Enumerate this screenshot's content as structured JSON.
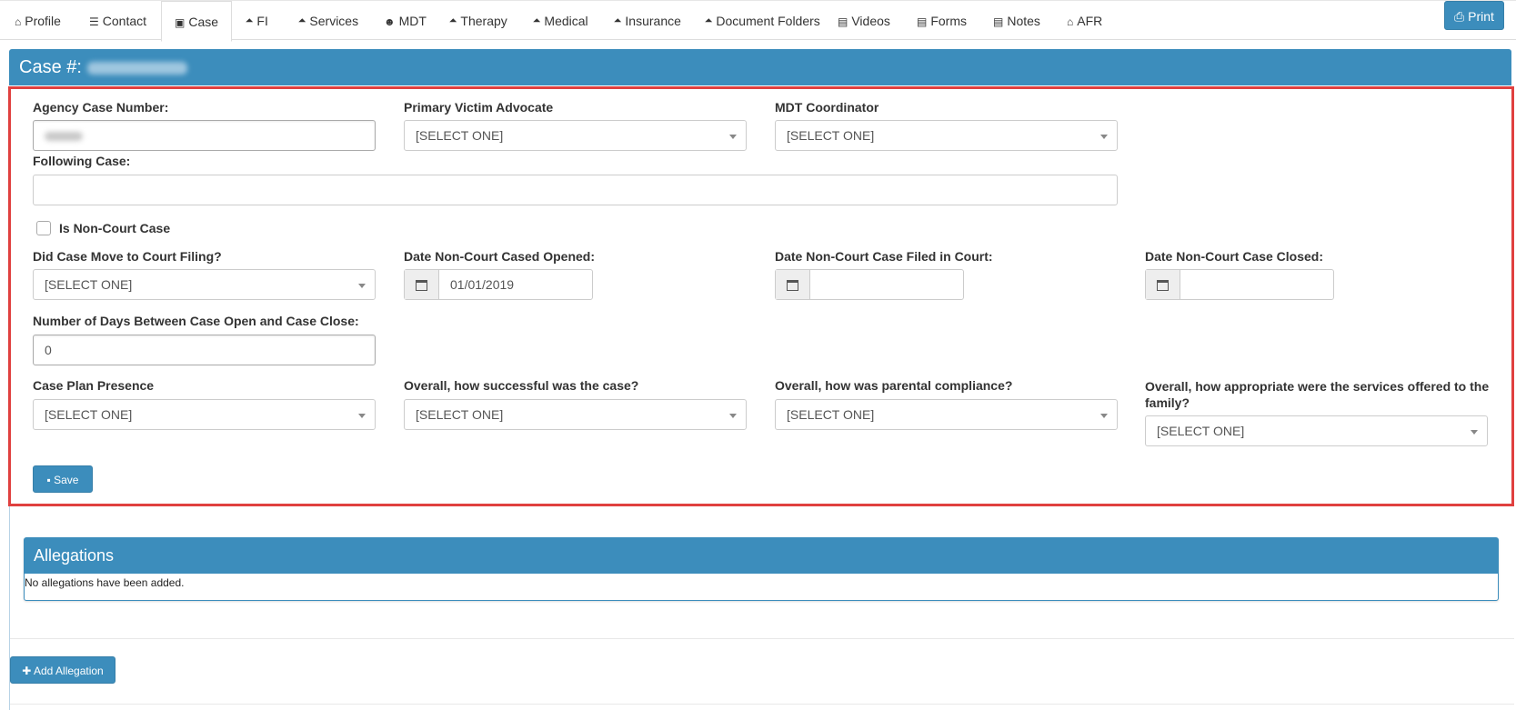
{
  "tabs": [
    {
      "label": "Profile",
      "icon": "⌂"
    },
    {
      "label": "Contact",
      "icon": "☰"
    },
    {
      "label": "Case",
      "icon": "▣"
    },
    {
      "label": "FI",
      "icon": "🞁"
    },
    {
      "label": "Services",
      "icon": "🞁"
    },
    {
      "label": "MDT",
      "icon": "☻"
    },
    {
      "label": "Therapy",
      "icon": "🞁"
    },
    {
      "label": "Medical",
      "icon": "🞁"
    },
    {
      "label": "Insurance",
      "icon": "🞁"
    },
    {
      "label": "Document Folders",
      "icon": "🞁"
    },
    {
      "label": "Videos",
      "icon": "▤"
    },
    {
      "label": "Forms",
      "icon": "▤"
    },
    {
      "label": "Notes",
      "icon": "▤"
    },
    {
      "label": "AFR",
      "icon": "⌂"
    }
  ],
  "print": {
    "label": "Print",
    "icon": "⎙"
  },
  "case": {
    "title": "Case #:",
    "labels": {
      "agency_case_number": "Agency Case Number:",
      "primary_victim_advocate": "Primary Victim Advocate",
      "mdt_coordinator": "MDT Coordinator",
      "following_case": "Following Case:",
      "is_non_court_case": "Is Non-Court Case",
      "did_case_move": "Did Case Move to Court Filing?",
      "date_opened": "Date Non-Court Cased Opened:",
      "date_filed": "Date Non-Court Case Filed in Court:",
      "date_closed": "Date Non-Court Case Closed:",
      "days_between": "Number of Days Between Case Open and Case Close:",
      "case_plan_presence": "Case Plan Presence",
      "overall_success": "Overall, how successful was the case?",
      "overall_compliance": "Overall, how was parental compliance?",
      "overall_services": "Overall, how appropriate were the services offered to the family?"
    },
    "values": {
      "select_placeholder": "[SELECT ONE]",
      "date_opened": "01/01/2019",
      "days_between": "0"
    },
    "save_label": "Save"
  },
  "allegations": {
    "title": "Allegations",
    "empty_text": "No allegations have been added.",
    "add_label": "Add Allegation"
  },
  "colors": {
    "primary": "#3c8dbc",
    "highlight": "#e0403f"
  }
}
